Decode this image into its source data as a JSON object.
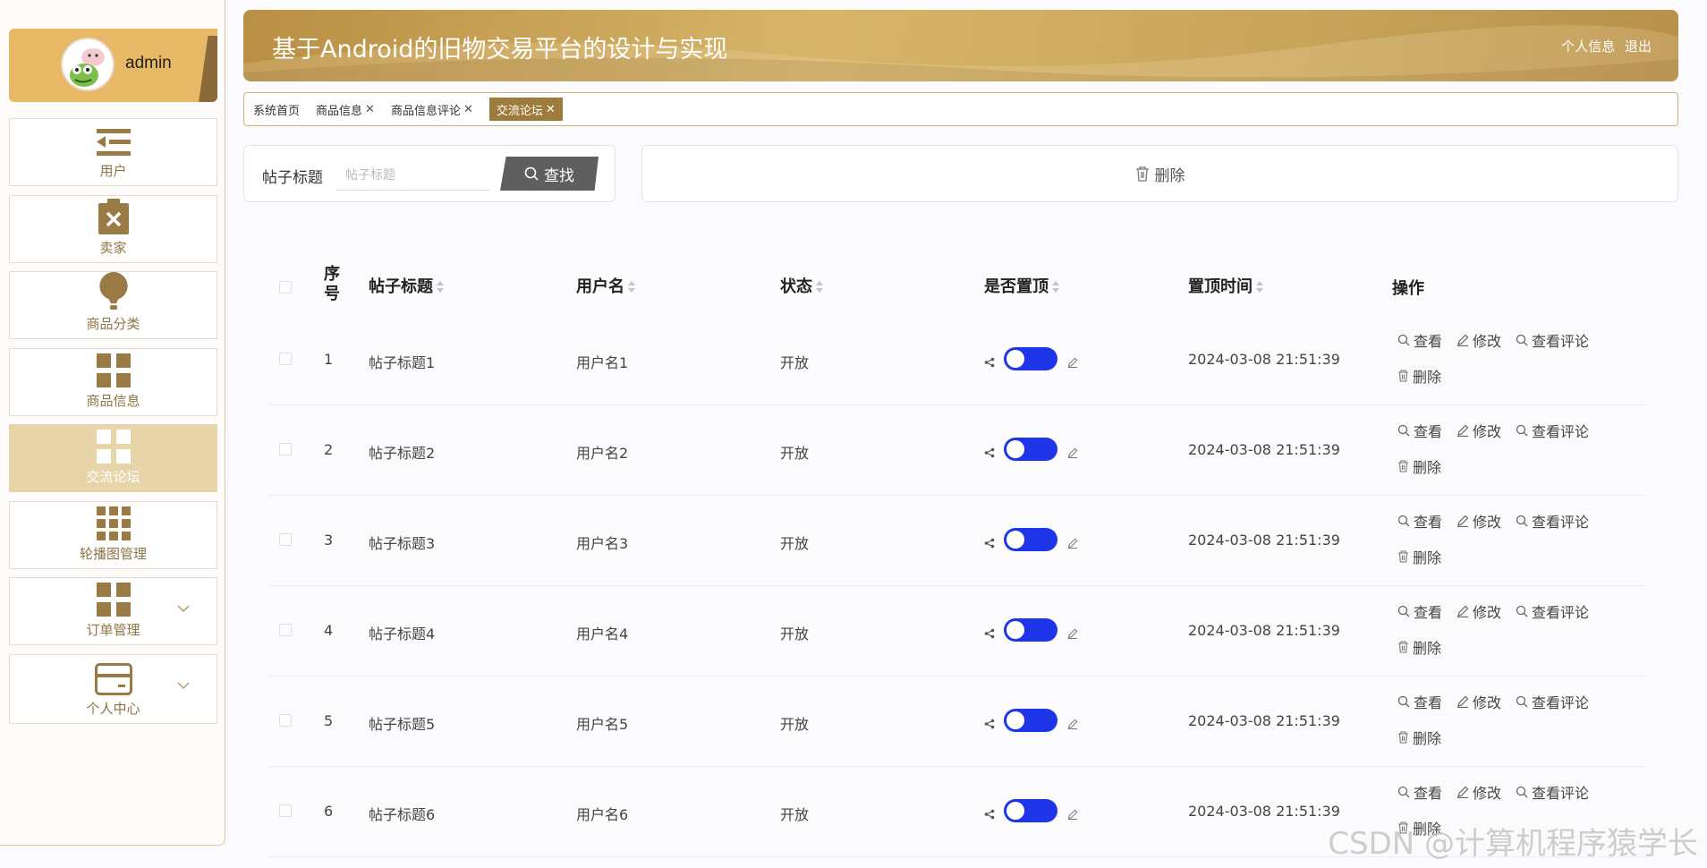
{
  "user": {
    "name": "admin"
  },
  "sidebar": {
    "items": [
      {
        "label": "用户",
        "icon": "user-list-icon",
        "active": false
      },
      {
        "label": "卖家",
        "icon": "clipboard-x-icon",
        "active": false
      },
      {
        "label": "商品分类",
        "icon": "lightbulb-icon",
        "active": false
      },
      {
        "label": "商品信息",
        "icon": "grid-icon",
        "active": false
      },
      {
        "label": "交流论坛",
        "icon": "grid-icon",
        "active": true
      },
      {
        "label": "轮播图管理",
        "icon": "nine-grid-icon",
        "active": false
      },
      {
        "label": "订单管理",
        "icon": "grid-icon",
        "active": false
      },
      {
        "label": "个人中心",
        "icon": "card-icon",
        "active": false
      }
    ]
  },
  "header": {
    "title": "基于Android的旧物交易平台的设计与实现",
    "profile_link": "个人信息",
    "logout_link": "退出"
  },
  "tabs": [
    {
      "label": "系统首页",
      "closable": false,
      "active": false
    },
    {
      "label": "商品信息",
      "closable": true,
      "active": false
    },
    {
      "label": "商品信息评论",
      "closable": true,
      "active": false
    },
    {
      "label": "交流论坛",
      "closable": true,
      "active": true
    }
  ],
  "search": {
    "label": "帖子标题",
    "placeholder": "帖子标题",
    "button": "查找"
  },
  "toolbar": {
    "delete_label": "删除"
  },
  "table": {
    "headers": {
      "index": "序号",
      "title": "帖子标题",
      "username": "用户名",
      "status": "状态",
      "pinned": "是否置顶",
      "pin_time": "置顶时间",
      "actions": "操作"
    },
    "actions": {
      "view": "查看",
      "edit": "修改",
      "view_comments": "查看评论",
      "delete": "删除"
    },
    "rows": [
      {
        "index": "1",
        "title": "帖子标题1",
        "username": "用户名1",
        "status": "开放",
        "pinned": true,
        "pin_time": "2024-03-08 21:51:39"
      },
      {
        "index": "2",
        "title": "帖子标题2",
        "username": "用户名2",
        "status": "开放",
        "pinned": true,
        "pin_time": "2024-03-08 21:51:39"
      },
      {
        "index": "3",
        "title": "帖子标题3",
        "username": "用户名3",
        "status": "开放",
        "pinned": true,
        "pin_time": "2024-03-08 21:51:39"
      },
      {
        "index": "4",
        "title": "帖子标题4",
        "username": "用户名4",
        "status": "开放",
        "pinned": true,
        "pin_time": "2024-03-08 21:51:39"
      },
      {
        "index": "5",
        "title": "帖子标题5",
        "username": "用户名5",
        "status": "开放",
        "pinned": true,
        "pin_time": "2024-03-08 21:51:39"
      },
      {
        "index": "6",
        "title": "帖子标题6",
        "username": "用户名6",
        "status": "开放",
        "pinned": true,
        "pin_time": "2024-03-08 21:51:39"
      }
    ]
  },
  "watermark": "CSDN @计算机程序猿学长",
  "colors": {
    "accent": "#9c7b3b",
    "toggle_on": "#1f35e8",
    "active_menu": "#e7d5a9"
  }
}
